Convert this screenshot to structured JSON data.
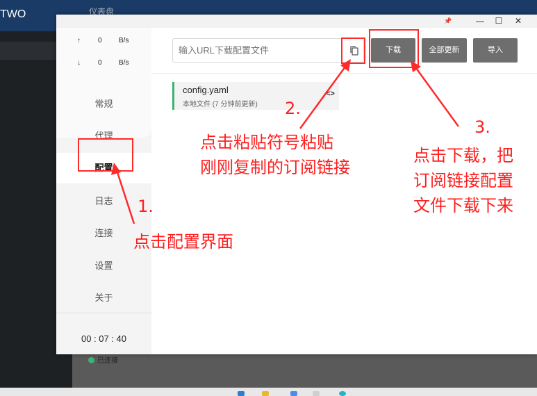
{
  "background": {
    "left_title": "TWO",
    "top_text": "仪表盘"
  },
  "window": {
    "controls": {
      "pin": "📌",
      "minimize": "—",
      "maximize": "☐",
      "close": "✕"
    }
  },
  "sidebar": {
    "upload": {
      "arrow": "↑",
      "value": "0",
      "unit": "B/s"
    },
    "download": {
      "arrow": "↓",
      "value": "0",
      "unit": "B/s"
    },
    "items": [
      {
        "label": "常规"
      },
      {
        "label": "代理"
      },
      {
        "label": "配置"
      },
      {
        "label": "日志"
      },
      {
        "label": "连接"
      },
      {
        "label": "设置"
      },
      {
        "label": "关于"
      }
    ],
    "timer": "00 : 07 : 40",
    "status": "已连接"
  },
  "main": {
    "url_placeholder": "输入URL下载配置文件",
    "download_button": "下载",
    "update_all_button": "全部更新",
    "import_button": "导入",
    "profile": {
      "name": "config.yaml",
      "subtitle": "本地文件 (7 分钟前更新)",
      "code_icon": "<>"
    }
  },
  "annotations": {
    "step1_number": "1.",
    "step1_text": "点击配置界面",
    "step2_number": "2.",
    "step2_text_line1": "点击粘贴符号粘贴",
    "step2_text_line2": "刚刚复制的订阅链接",
    "step3_number": "3.",
    "step3_text_line1": "点击下载，把",
    "step3_text_line2": "订阅链接配置",
    "step3_text_line3": "文件下载下来"
  },
  "colors": {
    "accent_green": "#3cb371",
    "annotation_red": "#ff1f1f",
    "button_gray": "#6e6e6e"
  }
}
